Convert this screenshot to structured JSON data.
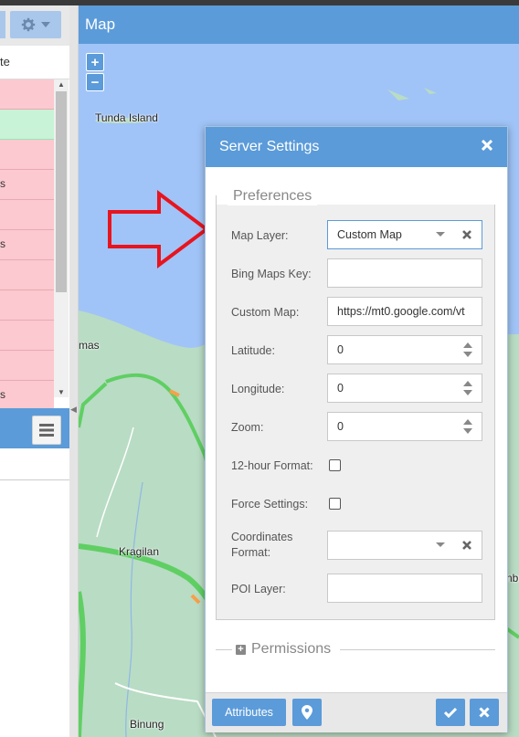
{
  "left_panel": {
    "header_text": "te",
    "rows": [
      {
        "text": "",
        "status": "red"
      },
      {
        "text": "",
        "status": "green"
      },
      {
        "text": "",
        "status": "red"
      },
      {
        "text": "s",
        "status": "red"
      },
      {
        "text": "",
        "status": "red"
      },
      {
        "text": "s",
        "status": "red"
      },
      {
        "text": "",
        "status": "red"
      },
      {
        "text": "",
        "status": "red"
      },
      {
        "text": "",
        "status": "red"
      },
      {
        "text": "",
        "status": "red"
      },
      {
        "text": "s",
        "status": "red"
      }
    ]
  },
  "map": {
    "title": "Map",
    "zoom_in": "+",
    "zoom_out": "−",
    "labels": {
      "tunda": "Tunda Island",
      "mas": "mas",
      "kragilan": "Kragilan",
      "binung": "Binung",
      "edge": "nbu"
    }
  },
  "dialog": {
    "title": "Server Settings",
    "preferences_legend": "Preferences",
    "permissions_legend": "Permissions",
    "fields": {
      "map_layer": {
        "label": "Map Layer:",
        "value": "Custom Map"
      },
      "bing_key": {
        "label": "Bing Maps Key:",
        "value": ""
      },
      "custom_map": {
        "label": "Custom Map:",
        "value": "https://mt0.google.com/vt"
      },
      "latitude": {
        "label": "Latitude:",
        "value": "0"
      },
      "longitude": {
        "label": "Longitude:",
        "value": "0"
      },
      "zoom": {
        "label": "Zoom:",
        "value": "0"
      },
      "twelve_hour": {
        "label": "12-hour Format:",
        "checked": false
      },
      "force_settings": {
        "label": "Force Settings:",
        "checked": false
      },
      "coordinates_format": {
        "label_line1": "Coordinates",
        "label_line2": "Format:",
        "value": ""
      },
      "poi_layer": {
        "label": "POI Layer:",
        "value": ""
      }
    },
    "footer": {
      "attributes_label": "Attributes"
    }
  },
  "colors": {
    "accent": "#5b9bd9",
    "row_red": "#fbc9cf",
    "row_green": "#c8f3d6",
    "water": "#a0c4f7",
    "land": "#b9dcc4",
    "road": "#5fcf63",
    "annotation_arrow": "#e8141e"
  }
}
